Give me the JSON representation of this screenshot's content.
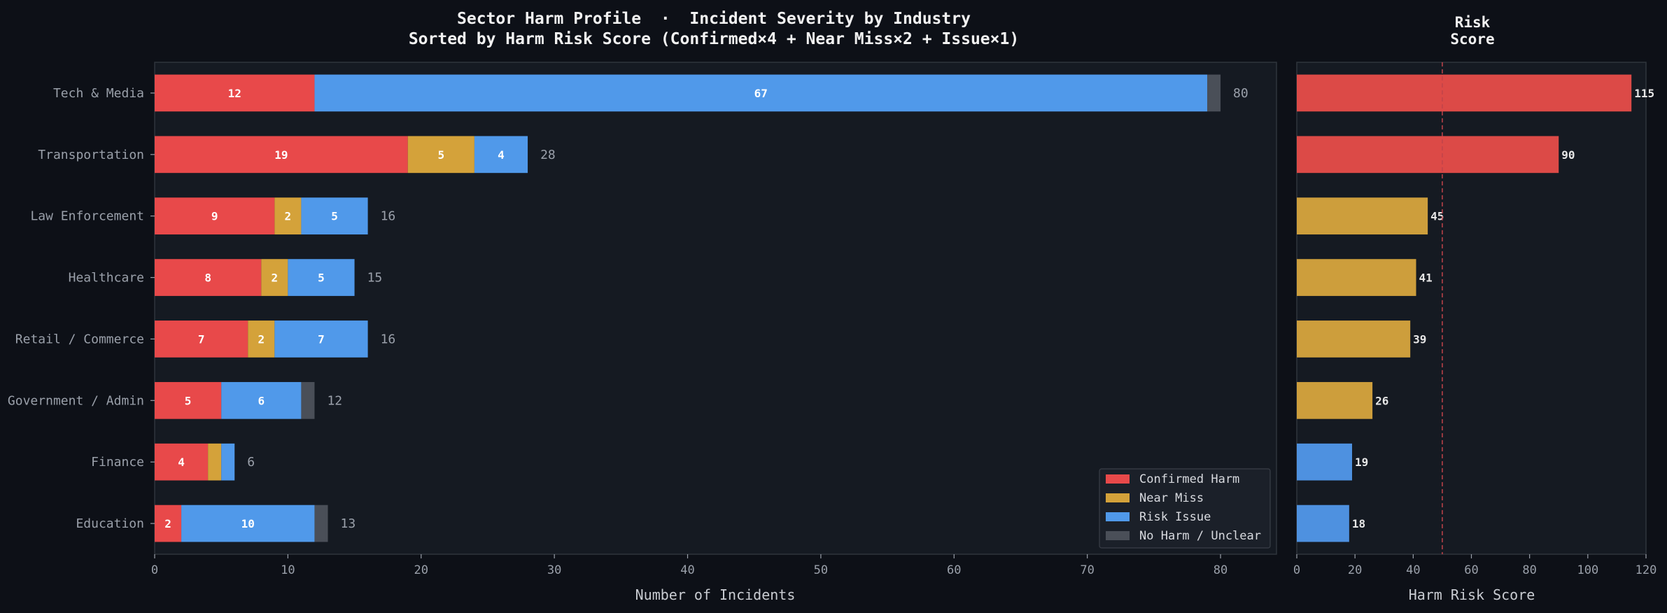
{
  "colors": {
    "background": "#0d1017",
    "panel": "#151a22",
    "confirmed": "#e8494a",
    "near_miss": "#d4a23a",
    "risk_issue": "#5099ea",
    "no_harm": "#4a4f58",
    "risk_high": "#dc4a47",
    "risk_mid": "#cd9e3c",
    "risk_low": "#4e91e0",
    "threshold_line": "#c0434a",
    "axis_text": "#9aa0aa",
    "title_text": "#f2f2f2"
  },
  "chart_data": [
    {
      "type": "bar",
      "orientation": "horizontal",
      "stacked": true,
      "title": "Sector Harm Profile  ·  Incident Severity by Industry",
      "subtitle": "Sorted by Harm Risk Score (Confirmed×4 + Near Miss×2 + Issue×1)",
      "xlabel": "Number of Incidents",
      "ylabel": "",
      "xlim": [
        0,
        84.2
      ],
      "xticks": [
        "0",
        "10",
        "20",
        "30",
        "40",
        "50",
        "60",
        "70",
        "80"
      ],
      "grid": false,
      "legend_position": "lower-right",
      "categories": [
        "Tech & Media",
        "Transportation",
        "Law Enforcement",
        "Healthcare",
        "Retail / Commerce",
        "Government / Admin",
        "Finance",
        "Education"
      ],
      "series": [
        {
          "name": "Confirmed Harm",
          "color": "#e8494a",
          "values": [
            12,
            19,
            9,
            8,
            7,
            5,
            4,
            2
          ]
        },
        {
          "name": "Near Miss",
          "color": "#d4a23a",
          "values": [
            0,
            5,
            2,
            2,
            2,
            0,
            1,
            0
          ]
        },
        {
          "name": "Risk Issue",
          "color": "#5099ea",
          "values": [
            67,
            4,
            5,
            5,
            7,
            6,
            1,
            10
          ]
        },
        {
          "name": "No Harm / Unclear",
          "color": "#4a4f58",
          "values": [
            1,
            0,
            0,
            0,
            0,
            1,
            0,
            1
          ]
        }
      ],
      "totals": [
        80,
        28,
        16,
        15,
        16,
        12,
        6,
        13
      ]
    },
    {
      "type": "bar",
      "orientation": "horizontal",
      "title": "Risk\nScore",
      "xlabel": "Harm Risk Score",
      "xlim": [
        0,
        120
      ],
      "xticks": [
        "0",
        "20",
        "40",
        "60",
        "80",
        "100",
        "120"
      ],
      "reference_line": 50,
      "categories": [
        "Tech & Media",
        "Transportation",
        "Law Enforcement",
        "Healthcare",
        "Retail / Commerce",
        "Government / Admin",
        "Finance",
        "Education"
      ],
      "values": [
        115,
        90,
        45,
        41,
        39,
        26,
        19,
        18
      ],
      "bar_colors": [
        "#dc4a47",
        "#dc4a47",
        "#cd9e3c",
        "#cd9e3c",
        "#cd9e3c",
        "#cd9e3c",
        "#4e91e0",
        "#4e91e0"
      ]
    }
  ]
}
